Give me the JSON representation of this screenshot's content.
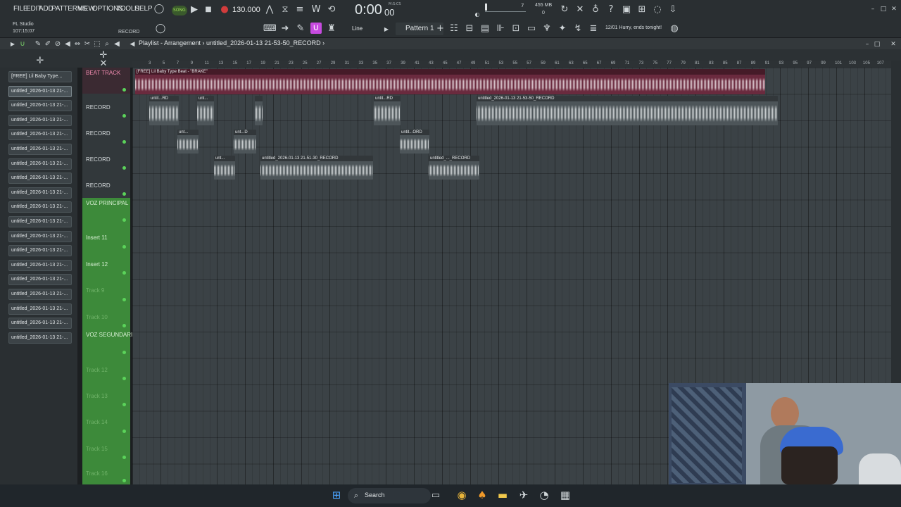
{
  "menu": [
    "FILE",
    "EDIT",
    "ADD",
    "PATTERNS",
    "VIEW",
    "OPTIONS",
    "TOOLS",
    "HELP"
  ],
  "transport": {
    "song_label": "SONG",
    "tempo": "130.000",
    "time": "0:00",
    "time_sub": "00",
    "time_unit": "M:S:CS"
  },
  "system": {
    "memory": "455 MB",
    "mem_val": "0",
    "cpu": "7"
  },
  "info": {
    "app": "FL Studio",
    "time": "107:15:07",
    "record_label": "RECORD"
  },
  "toolbar": {
    "snap": "Line",
    "pattern": "Pattern 1",
    "news": "12/01   Hurry, ends tonight!"
  },
  "playlist": {
    "breadcrumb": "Playlist - Arrangement",
    "clip_name": "untitled_2026-01-13 21-53-50_RECORD"
  },
  "picker": {
    "items": [
      "[FREE] Lil Baby Type...",
      "untitled_2026-01-13 21-...",
      "untitled_2026-01-13 21-...",
      "untitled_2026-01-13 21-...",
      "untitled_2026-01-13 21-...",
      "untitled_2026-01-13 21-...",
      "untitled_2026-01-13 21-...",
      "untitled_2026-01-13 21-...",
      "untitled_2026-01-13 21-...",
      "untitled_2026-01-13 21-...",
      "untitled_2026-01-13 21-...",
      "untitled_2026-01-13 21-...",
      "untitled_2026-01-13 21-...",
      "untitled_2026-01-13 21-...",
      "untitled_2026-01-13 21-...",
      "untitled_2026-01-13 21-...",
      "untitled_2026-01-13 21-...",
      "untitled_2026-01-13 21-...",
      "untitled_2026-01-13 21-..."
    ]
  },
  "ruler": [
    "3",
    "5",
    "7",
    "9",
    "11",
    "13",
    "15",
    "17",
    "19",
    "21",
    "23",
    "25",
    "27",
    "29",
    "31",
    "33",
    "35",
    "37",
    "39",
    "41",
    "43",
    "45",
    "47",
    "49",
    "51",
    "53",
    "55",
    "57",
    "59",
    "61",
    "63",
    "65",
    "67",
    "69",
    "71",
    "73",
    "75",
    "77",
    "79",
    "81",
    "83",
    "85",
    "87",
    "89",
    "91",
    "93",
    "95",
    "97",
    "99",
    "101",
    "103",
    "105",
    "107"
  ],
  "tracks": [
    {
      "name": "BEAT TRACK",
      "style": "beat"
    },
    {
      "name": "RECORD",
      "style": "plain"
    },
    {
      "name": "RECORD",
      "style": "plain"
    },
    {
      "name": "RECORD",
      "style": "plain"
    },
    {
      "name": "RECORD",
      "style": "plain"
    },
    {
      "name": "VOZ PRINCIPAL",
      "style": "green"
    },
    {
      "name": "Insert 11",
      "style": "green"
    },
    {
      "name": "Insert 12",
      "style": "green"
    },
    {
      "name": "Track 9",
      "style": "green-dim"
    },
    {
      "name": "Track 10",
      "style": "green-dim"
    },
    {
      "name": "VOZ SEGUNDARIA",
      "style": "green"
    },
    {
      "name": "Track 12",
      "style": "green-dim"
    },
    {
      "name": "Track 13",
      "style": "green-dim"
    },
    {
      "name": "Track 14",
      "style": "green-dim"
    },
    {
      "name": "Track 15",
      "style": "green-dim"
    },
    {
      "name": "Track 16",
      "style": "green-dim"
    }
  ],
  "clips": [
    {
      "label": "[FREE] Lil Baby Type Beat - \"BRAKE\"",
      "kind": "beat"
    },
    {
      "label": "untit...RD",
      "kind": "audio"
    },
    {
      "label": "unt...",
      "kind": "audio"
    },
    {
      "label": "",
      "kind": "audio"
    },
    {
      "label": "untit...RD",
      "kind": "audio"
    },
    {
      "label": "untitled_2026-01-13 21-53-50_RECORD",
      "kind": "audio"
    },
    {
      "label": "unt...",
      "kind": "audio"
    },
    {
      "label": "unt...D",
      "kind": "audio"
    },
    {
      "label": "untit...ORD",
      "kind": "audio"
    },
    {
      "label": "unt...",
      "kind": "audio"
    },
    {
      "label": "untitled_2026-01-13 21-51-30_RECORD",
      "kind": "audio"
    },
    {
      "label": "untitled_..._RECORD",
      "kind": "audio"
    }
  ],
  "taskbar": {
    "search": "Search"
  }
}
